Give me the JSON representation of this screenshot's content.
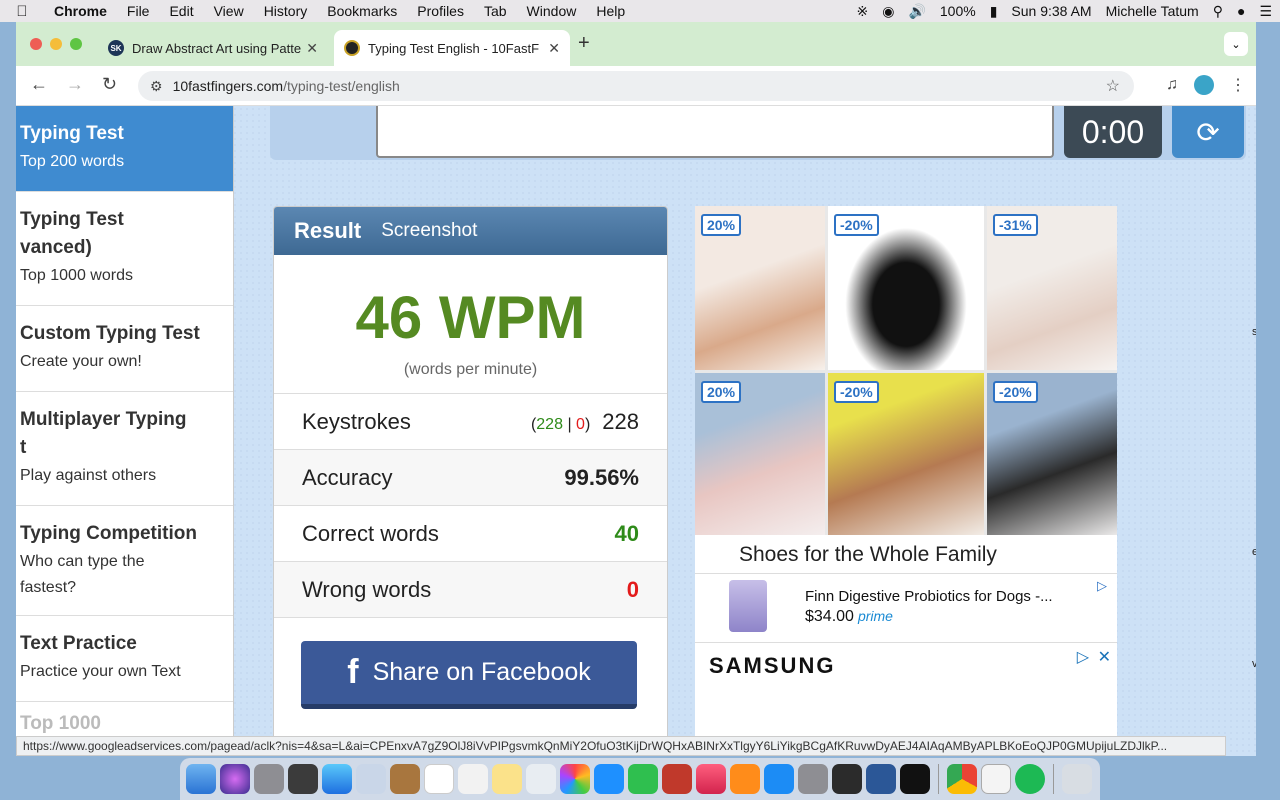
{
  "menubar": {
    "apple": "",
    "app": "Chrome",
    "items": [
      "File",
      "Edit",
      "View",
      "History",
      "Bookmarks",
      "Profiles",
      "Tab",
      "Window",
      "Help"
    ],
    "battery": "100%",
    "clock": "Sun 9:38 AM",
    "user": "Michelle Tatum"
  },
  "tabs": [
    {
      "title": "Draw Abstract Art using Patte",
      "favicon": "SK"
    },
    {
      "title": "Typing Test English - 10FastF",
      "favicon": ""
    }
  ],
  "omnibox": {
    "domain": "10fastfingers.com",
    "path": "/typing-test/english"
  },
  "sidebar": [
    {
      "title": "Typing Test",
      "sub": "Top 200 words"
    },
    {
      "title": "Typing Test",
      "title2": "vanced)",
      "sub": "Top 1000 words"
    },
    {
      "title": "Custom Typing Test",
      "sub": "Create your own!"
    },
    {
      "title": "Multiplayer Typing",
      "title2": "t",
      "sub": "Play against others"
    },
    {
      "title": "Typing Competition",
      "sub": "Who can type the",
      "sub2": "fastest?"
    },
    {
      "title": "Text Practice",
      "sub": "Practice your own Text"
    },
    {
      "title": "Top 1000"
    }
  ],
  "timer": "0:00",
  "result": {
    "tab_result": "Result",
    "tab_screenshot": "Screenshot",
    "wpm": "46 WPM",
    "wpm_sub": "(words per minute)",
    "rows": {
      "keystrokes": {
        "label": "Keystrokes",
        "open": "(",
        "correct": "228",
        "sep": "|",
        "wrong": "0",
        "close": ")",
        "total": "228"
      },
      "accuracy": {
        "label": "Accuracy",
        "value": "99.56%"
      },
      "correct_words": {
        "label": "Correct words",
        "value": "40"
      },
      "wrong_words": {
        "label": "Wrong words",
        "value": "0"
      }
    },
    "share": "Share on Facebook"
  },
  "ad": {
    "badges": [
      "20%",
      "-20%",
      "-31%",
      "20%",
      "-20%",
      "-20%"
    ],
    "title": "Shoes for the Whole Family",
    "product": {
      "name": "Finn Digestive Probiotics for Dogs -...",
      "price": "$34.00",
      "prime": "prime"
    },
    "samsung": "SAMSUNG"
  },
  "edge_text": [
    "s",
    "et",
    "val"
  ],
  "statusbar": "https://www.googleadservices.com/pagead/aclk?nis=4&sa=L&ai=CPEnxvA7gZ9OlJ8iVvPIPgsvmkQnMiY2OfuO3tKijDrWQHxABINrXxTlgyY6LiYikgBCgAfKRuvwDyAEJ4AIAqAMByAPLBKoEoQJP0GMUpijuLZDJlkP..."
}
